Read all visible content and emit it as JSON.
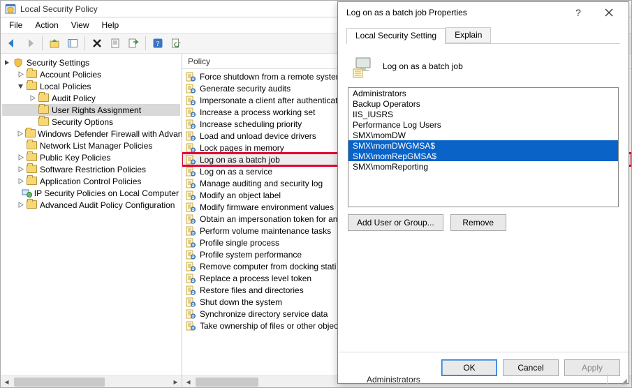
{
  "window": {
    "title": "Local Security Policy"
  },
  "menubar": [
    "File",
    "Action",
    "View",
    "Help"
  ],
  "tree": {
    "root": "Security Settings",
    "nodes": [
      {
        "label": "Account Policies",
        "expandable": true,
        "depth": 1
      },
      {
        "label": "Local Policies",
        "expandable": true,
        "expanded": true,
        "depth": 1
      },
      {
        "label": "Audit Policy",
        "expandable": true,
        "depth": 2
      },
      {
        "label": "User Rights Assignment",
        "depth": 2,
        "selected": true
      },
      {
        "label": "Security Options",
        "depth": 2
      },
      {
        "label": "Windows Defender Firewall with Advan",
        "expandable": true,
        "depth": 1
      },
      {
        "label": "Network List Manager Policies",
        "depth": 1
      },
      {
        "label": "Public Key Policies",
        "expandable": true,
        "depth": 1
      },
      {
        "label": "Software Restriction Policies",
        "expandable": true,
        "depth": 1
      },
      {
        "label": "Application Control Policies",
        "expandable": true,
        "depth": 1
      },
      {
        "label": "IP Security Policies on Local Computer",
        "depth": 1,
        "ip": true
      },
      {
        "label": "Advanced Audit Policy Configuration",
        "expandable": true,
        "depth": 1
      }
    ]
  },
  "list": {
    "header": "Policy",
    "items": [
      "Force shutdown from a remote system",
      "Generate security audits",
      "Impersonate a client after authenticati",
      "Increase a process working set",
      "Increase scheduling priority",
      "Load and unload device drivers",
      "Lock pages in memory",
      "Log on as a batch job",
      "Log on as a service",
      "Manage auditing and security log",
      "Modify an object label",
      "Modify firmware environment values",
      "Obtain an impersonation token for an",
      "Perform volume maintenance tasks",
      "Profile single process",
      "Profile system performance",
      "Remove computer from docking stati",
      "Replace a process level token",
      "Restore files and directories",
      "Shut down the system",
      "Synchronize directory service data",
      "Take ownership of files or other objects"
    ],
    "selected_index": 7,
    "highlighted_index": 7
  },
  "dialog": {
    "title": "Log on as a batch job Properties",
    "tabs": {
      "active": "Local Security Setting",
      "other": "Explain"
    },
    "policy_name": "Log on as a batch job",
    "users": [
      {
        "name": "Administrators",
        "sel": false
      },
      {
        "name": "Backup Operators",
        "sel": false
      },
      {
        "name": "IIS_IUSRS",
        "sel": false
      },
      {
        "name": "Performance Log Users",
        "sel": false
      },
      {
        "name": "SMX\\momDW",
        "sel": false
      },
      {
        "name": "SMX\\momDWGMSA$",
        "sel": true
      },
      {
        "name": "SMX\\momRepGMSA$",
        "sel": true
      },
      {
        "name": "SMX\\momReporting",
        "sel": false
      }
    ],
    "buttons": {
      "add": "Add User or Group...",
      "remove": "Remove",
      "ok": "OK",
      "cancel": "Cancel",
      "apply": "Apply"
    }
  },
  "status": {
    "text": "Administrators"
  }
}
